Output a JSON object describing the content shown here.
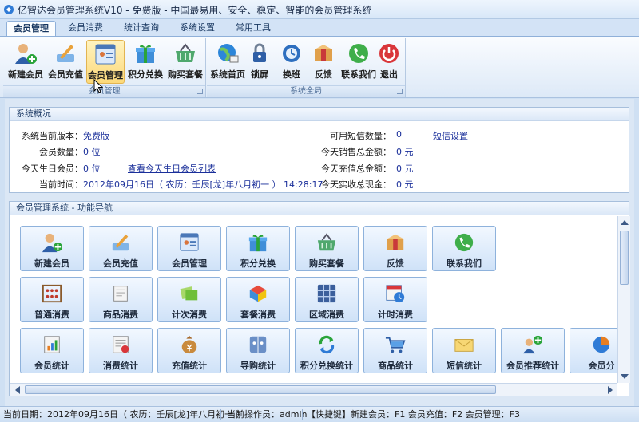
{
  "window": {
    "title": "亿智达会员管理系统V10 - 免费版 - 中国最易用、安全、稳定、智能的会员管理系统"
  },
  "tabs": [
    {
      "label": "会员管理",
      "active": true
    },
    {
      "label": "会员消费",
      "active": false
    },
    {
      "label": "统计查询",
      "active": false
    },
    {
      "label": "系统设置",
      "active": false
    },
    {
      "label": "常用工具",
      "active": false
    }
  ],
  "ribbon": {
    "groups": [
      {
        "title": "会员管理",
        "buttons": [
          {
            "label": "新建会员",
            "icon": "add-member-icon"
          },
          {
            "label": "会员充值",
            "icon": "recharge-icon"
          },
          {
            "label": "会员管理",
            "icon": "member-manage-icon",
            "hovered": true
          },
          {
            "label": "积分兑换",
            "icon": "gift-icon"
          },
          {
            "label": "购买套餐",
            "icon": "basket-icon"
          }
        ]
      },
      {
        "title": "系统全局",
        "buttons": [
          {
            "label": "系统首页",
            "icon": "globe-home-icon"
          },
          {
            "label": "锁屏",
            "icon": "lock-icon"
          },
          {
            "label": "换班",
            "icon": "shift-change-icon"
          },
          {
            "label": "反馈",
            "icon": "feedback-box-icon"
          },
          {
            "label": "联系我们",
            "icon": "phone-icon"
          },
          {
            "label": "退出",
            "icon": "power-icon"
          }
        ]
      }
    ]
  },
  "overview": {
    "title": "系统概况",
    "version_label": "系统当前版本：",
    "version_value": "免费版",
    "member_count_label": "会员数量：",
    "member_count_value": "0 位",
    "birthday_label": "今天生日会员：",
    "birthday_value": "0 位",
    "birthday_link": "查看今天生日会员列表",
    "time_label": "当前时间：",
    "time_value": "2012年09月16日（ 农历：壬辰[龙]年八月初一 ）   14:28:17",
    "sms_label": "可用短信数量：",
    "sms_value": "0",
    "sms_link": "短信设置",
    "sales_label": "今天销售总金额：",
    "sales_value": "0 元",
    "recharge_label": "今天充值总金额：",
    "recharge_value": "0 元",
    "cash_label": "今天实收总现金：",
    "cash_value": "0 元"
  },
  "nav": {
    "title": "会员管理系统 - 功能导航",
    "rows": [
      [
        {
          "label": "新建会员",
          "icon": "add-member-icon"
        },
        {
          "label": "会员充值",
          "icon": "recharge-icon"
        },
        {
          "label": "会员管理",
          "icon": "member-manage-icon"
        },
        {
          "label": "积分兑换",
          "icon": "gift-icon"
        },
        {
          "label": "购买套餐",
          "icon": "basket-icon"
        },
        {
          "label": "反馈",
          "icon": "feedback-box-icon"
        },
        {
          "label": "联系我们",
          "icon": "phone-icon"
        }
      ],
      [
        {
          "label": "普通消费",
          "icon": "abacus-icon"
        },
        {
          "label": "商品消费",
          "icon": "goods-icon"
        },
        {
          "label": "计次消费",
          "icon": "ticket-icon"
        },
        {
          "label": "套餐消费",
          "icon": "package-icon"
        },
        {
          "label": "区域消费",
          "icon": "grid-area-icon"
        },
        {
          "label": "计时消费",
          "icon": "clock-calendar-icon"
        }
      ],
      [
        {
          "label": "会员统计",
          "icon": "member-stat-icon"
        },
        {
          "label": "消费统计",
          "icon": "consume-stat-icon"
        },
        {
          "label": "充值统计",
          "icon": "money-bag-icon"
        },
        {
          "label": "导购统计",
          "icon": "guide-stat-icon"
        },
        {
          "label": "积分兑换统计",
          "icon": "refresh-points-icon"
        },
        {
          "label": "商品统计",
          "icon": "cart-icon"
        },
        {
          "label": "短信统计",
          "icon": "sms-envelope-icon"
        },
        {
          "label": "会员推荐统计",
          "icon": "referral-icon"
        },
        {
          "label": "会员分",
          "icon": "member-group-icon"
        }
      ]
    ]
  },
  "status": {
    "date": "当前日期：2012年09月16日（ 农历：壬辰[龙]年八月初一 ）",
    "operator": "当前操作员：admin",
    "shortcuts": "【快捷键】新建会员：F1  会员充值：F2  会员管理：F3"
  }
}
